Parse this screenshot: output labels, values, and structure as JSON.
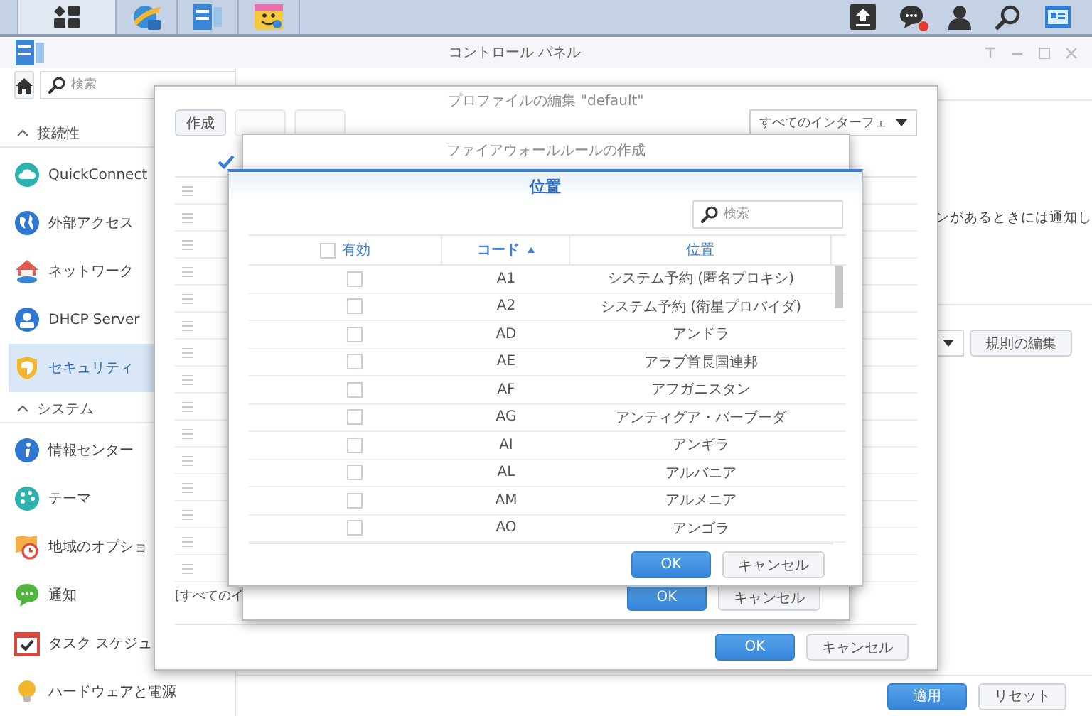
{
  "taskbar": {
    "apps": [
      {
        "kind": "grid",
        "selected": true
      },
      {
        "kind": "globe",
        "selected": false
      },
      {
        "kind": "panel",
        "selected": false
      },
      {
        "kind": "smiley",
        "selected": false
      }
    ],
    "tray": [
      {
        "kind": "upload",
        "has_badge": false
      },
      {
        "kind": "chat",
        "has_badge": true
      },
      {
        "kind": "user",
        "has_badge": false
      },
      {
        "kind": "search",
        "has_badge": false
      },
      {
        "kind": "widget",
        "has_badge": false
      }
    ]
  },
  "window": {
    "title": "コントロール パネル"
  },
  "sidebar": {
    "search": {
      "placeholder": "検索"
    },
    "sections": [
      {
        "label": "接続性",
        "expanded": true,
        "items": [
          {
            "label": "QuickConnect",
            "kind": "cloud",
            "selected": false
          },
          {
            "label": "外部アクセス",
            "kind": "globe",
            "selected": false
          },
          {
            "label": "ネットワーク",
            "kind": "house",
            "selected": false
          },
          {
            "label": "DHCP Server",
            "kind": "server",
            "selected": false
          },
          {
            "label": "セキュリティ",
            "kind": "shield",
            "selected": true
          }
        ]
      },
      {
        "label": "システム",
        "expanded": true,
        "items": [
          {
            "label": "情報センター",
            "kind": "info",
            "selected": false
          },
          {
            "label": "テーマ",
            "kind": "palette",
            "selected": false
          },
          {
            "label": "地域のオプショ",
            "kind": "region",
            "selected": false
          },
          {
            "label": "通知",
            "kind": "bubble",
            "selected": false
          },
          {
            "label": "タスク スケジュ",
            "kind": "calendar",
            "selected": false
          },
          {
            "label": "ハードウェアと電源",
            "kind": "bulb",
            "selected": false
          }
        ]
      }
    ]
  },
  "main": {
    "notice_text": "ンがあるときには通知し",
    "edit_rules_button": "規則の編集",
    "apply_button": "適用",
    "reset_button": "リセット"
  },
  "profile_dialog": {
    "title": "プロファイルの編集 \"default\"",
    "toolbar": [
      {
        "label": "作成",
        "disabled": false
      },
      {
        "disabled": true
      },
      {
        "disabled": true
      }
    ],
    "interface_select": {
      "value": "すべてのインターフェ"
    },
    "select_all_checked": true,
    "footer_text": "[すべてのイ",
    "ok_button": "OK",
    "cancel_button": "キャンセル"
  },
  "rule_dialog": {
    "title": "ファイアウォールルールの作成",
    "ok_button": "OK",
    "cancel_button": "キャンセル"
  },
  "location_dialog": {
    "title": "位置",
    "search": {
      "placeholder": "検索"
    },
    "select_all_checked": false,
    "columns": [
      {
        "label": "有効",
        "kind": "check",
        "sorted": false
      },
      {
        "label": "コード",
        "kind": "text",
        "sorted": true
      },
      {
        "label": "位置",
        "kind": "text",
        "sorted": false
      }
    ],
    "rows": [
      {
        "code": "A1",
        "name": "システム予約 (匿名プロキシ)",
        "checked": false
      },
      {
        "code": "A2",
        "name": "システム予約 (衛星プロバイダ)",
        "checked": false
      },
      {
        "code": "AD",
        "name": "アンドラ",
        "checked": false
      },
      {
        "code": "AE",
        "name": "アラブ首長国連邦",
        "checked": false
      },
      {
        "code": "AF",
        "name": "アフガニスタン",
        "checked": false
      },
      {
        "code": "AG",
        "name": "アンティグア・バーブーダ",
        "checked": false
      },
      {
        "code": "AI",
        "name": "アンギラ",
        "checked": false
      },
      {
        "code": "AL",
        "name": "アルバニア",
        "checked": false
      },
      {
        "code": "AM",
        "name": "アルメニア",
        "checked": false
      },
      {
        "code": "AO",
        "name": "アンゴラ",
        "checked": false
      }
    ],
    "ok_button": "OK",
    "cancel_button": "キャンセル"
  }
}
